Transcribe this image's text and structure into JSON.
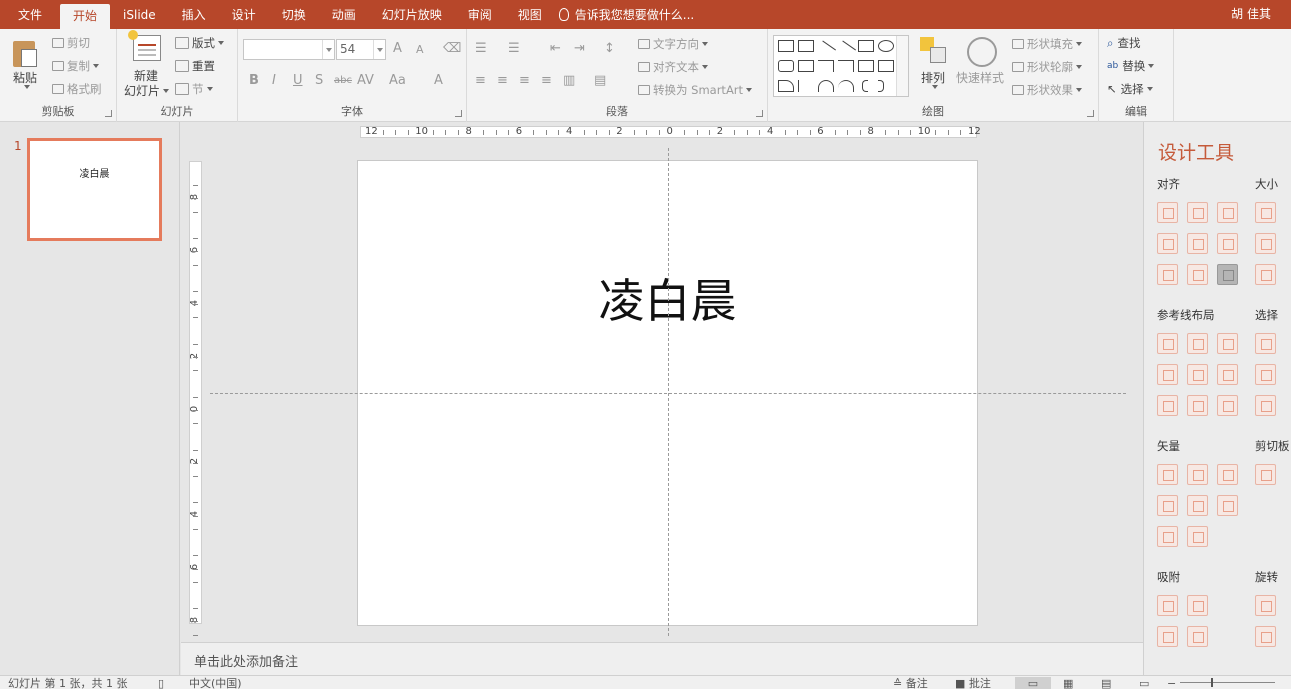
{
  "tabs": [
    "文件",
    "开始",
    "iSlide",
    "插入",
    "设计",
    "切换",
    "动画",
    "幻灯片放映",
    "审阅",
    "视图"
  ],
  "active_tab": "开始",
  "tell_me": "告诉我您想要做什么...",
  "user_name": "胡 佳其",
  "ribbon": {
    "clipboard": {
      "label": "剪贴板",
      "paste": "粘贴",
      "cut": "剪切",
      "copy": "复制",
      "format_painter": "格式刷"
    },
    "slides": {
      "label": "幻灯片",
      "new_slide": "新建",
      "new_slide_2": "幻灯片",
      "layout": "版式",
      "reset": "重置",
      "section": "节"
    },
    "font": {
      "label": "字体",
      "font_name": "",
      "font_size": "54",
      "grow": "A",
      "shrink": "A",
      "bold": "B",
      "italic": "I",
      "underline": "U",
      "shadow": "S",
      "strike": "abc",
      "spacing": "AV",
      "case": "Aa",
      "color": "A"
    },
    "paragraph": {
      "label": "段落",
      "text_direction": "文字方向",
      "align_text": "对齐文本",
      "smartart": "转换为 SmartArt"
    },
    "drawing": {
      "label": "绘图",
      "arrange": "排列",
      "quick_styles": "快速样式",
      "shape_fill": "形状填充",
      "shape_outline": "形状轮廓",
      "shape_effects": "形状效果"
    },
    "editing": {
      "label": "编辑",
      "find": "查找",
      "replace": "替换",
      "select": "选择"
    }
  },
  "slides": [
    {
      "number": "1",
      "title": "凌白晨"
    }
  ],
  "slide_title": "凌白晨",
  "ruler_h_labels": [
    "12",
    "10",
    "8",
    "6",
    "4",
    "2",
    "0",
    "2",
    "4",
    "6",
    "8",
    "10",
    "12"
  ],
  "ruler_v_labels": [
    "8",
    "6",
    "4",
    "2",
    "0",
    "2",
    "4",
    "6",
    "8"
  ],
  "notes_placeholder": "单击此处添加备注",
  "design_tools": {
    "title": "设计工具",
    "align": "对齐",
    "size": "大小",
    "guides": "参考线布局",
    "select": "选择",
    "vector": "矢量",
    "clipboard": "剪切板",
    "snap": "吸附",
    "rotate": "旋转"
  },
  "status": {
    "slide_info": "幻灯片 第 1 张，共 1 张",
    "language": "中文(中国)",
    "notes": "备注",
    "comments": "批注"
  },
  "colors": {
    "accent": "#b7472a",
    "ribbon_bg": "#f3f3f3",
    "tool_title": "#c55a3a"
  }
}
